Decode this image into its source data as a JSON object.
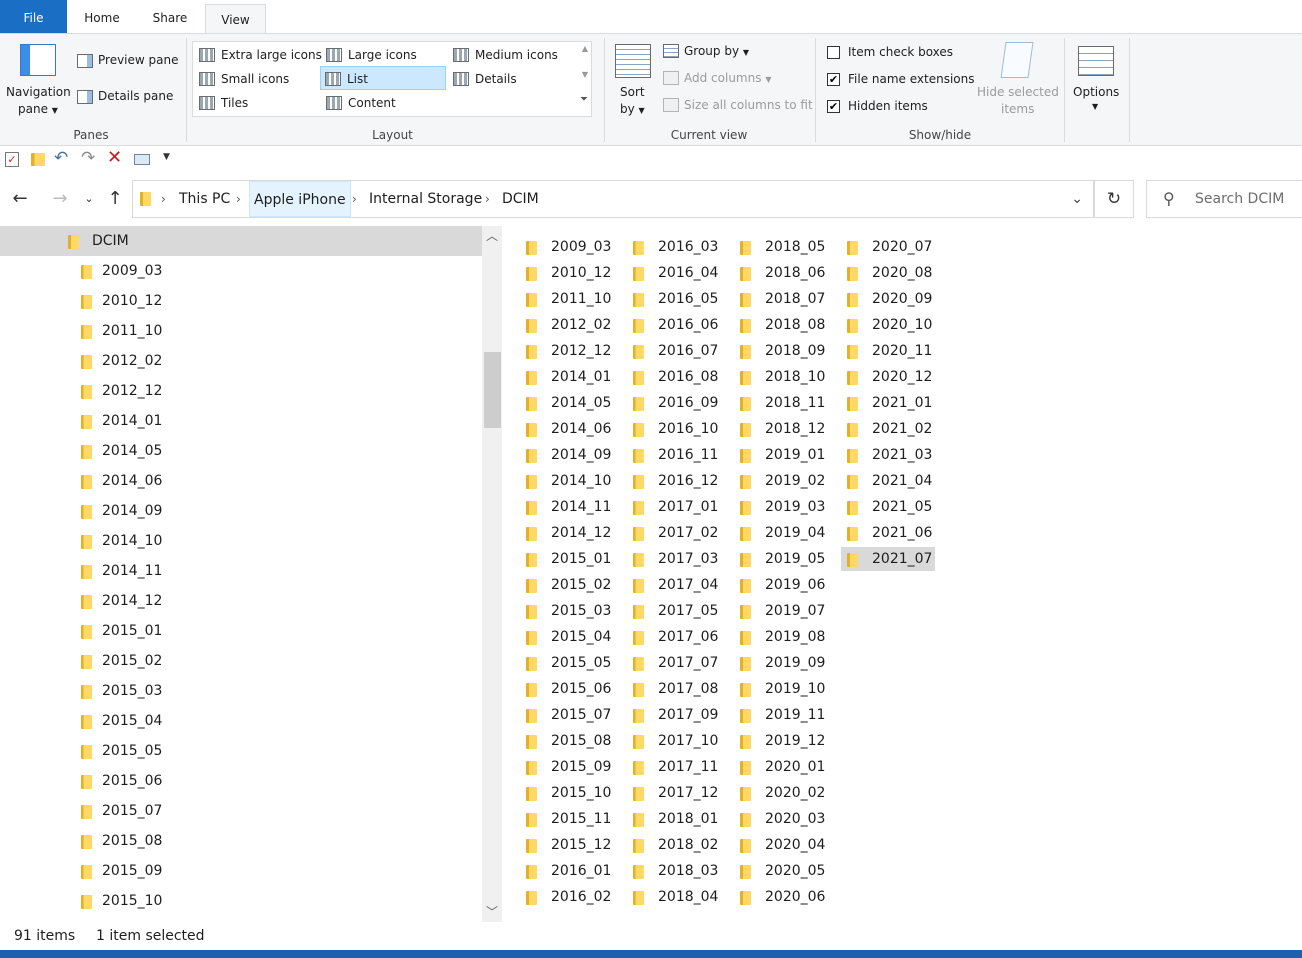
{
  "ribbon": {
    "tabs": {
      "file": "File",
      "home": "Home",
      "share": "Share",
      "view": "View"
    },
    "panes": {
      "navigation_pane_line1": "Navigation",
      "navigation_pane_line2": "pane",
      "preview_pane": "Preview pane",
      "details_pane": "Details pane",
      "group_label": "Panes"
    },
    "layout": {
      "items": [
        "Extra large icons",
        "Large icons",
        "Medium icons",
        "Small icons",
        "List",
        "Details",
        "Tiles",
        "Content"
      ],
      "selected": "List",
      "group_label": "Layout"
    },
    "current_view": {
      "sort_line1": "Sort",
      "sort_line2": "by",
      "group_by": "Group by",
      "add_columns": "Add columns",
      "size_all_columns": "Size all columns to fit",
      "group_label": "Current view"
    },
    "show_hide": {
      "item_check_boxes": "Item check boxes",
      "file_name_extensions": "File name extensions",
      "hidden_items": "Hidden items",
      "hide_selected_line1": "Hide selected",
      "hide_selected_line2": "items",
      "group_label": "Show/hide",
      "checked": {
        "item_check_boxes": false,
        "file_name_extensions": true,
        "hidden_items": true
      }
    },
    "options": "Options"
  },
  "address": {
    "crumbs": [
      "This PC",
      "Apple iPhone",
      "Internal Storage",
      "DCIM"
    ]
  },
  "search": {
    "placeholder": "Search DCIM"
  },
  "nav_pane": {
    "root": "DCIM",
    "items": [
      "2009_03",
      "2010_12",
      "2011_10",
      "2012_02",
      "2012_12",
      "2014_01",
      "2014_05",
      "2014_06",
      "2014_09",
      "2014_10",
      "2014_11",
      "2014_12",
      "2015_01",
      "2015_02",
      "2015_03",
      "2015_04",
      "2015_05",
      "2015_06",
      "2015_07",
      "2015_08",
      "2015_09",
      "2015_10"
    ]
  },
  "files": {
    "columns": [
      [
        "2009_03",
        "2010_12",
        "2011_10",
        "2012_02",
        "2012_12",
        "2014_01",
        "2014_05",
        "2014_06",
        "2014_09",
        "2014_10",
        "2014_11",
        "2014_12",
        "2015_01",
        "2015_02",
        "2015_03",
        "2015_04",
        "2015_05",
        "2015_06",
        "2015_07",
        "2015_08",
        "2015_09",
        "2015_10",
        "2015_11",
        "2015_12",
        "2016_01",
        "2016_02"
      ],
      [
        "2016_03",
        "2016_04",
        "2016_05",
        "2016_06",
        "2016_07",
        "2016_08",
        "2016_09",
        "2016_10",
        "2016_11",
        "2016_12",
        "2017_01",
        "2017_02",
        "2017_03",
        "2017_04",
        "2017_05",
        "2017_06",
        "2017_07",
        "2017_08",
        "2017_09",
        "2017_10",
        "2017_11",
        "2017_12",
        "2018_01",
        "2018_02",
        "2018_03",
        "2018_04"
      ],
      [
        "2018_05",
        "2018_06",
        "2018_07",
        "2018_08",
        "2018_09",
        "2018_10",
        "2018_11",
        "2018_12",
        "2019_01",
        "2019_02",
        "2019_03",
        "2019_04",
        "2019_05",
        "2019_06",
        "2019_07",
        "2019_08",
        "2019_09",
        "2019_10",
        "2019_11",
        "2019_12",
        "2020_01",
        "2020_02",
        "2020_03",
        "2020_04",
        "2020_05",
        "2020_06"
      ],
      [
        "2020_07",
        "2020_08",
        "2020_09",
        "2020_10",
        "2020_11",
        "2020_12",
        "2021_01",
        "2021_02",
        "2021_03",
        "2021_04",
        "2021_05",
        "2021_06",
        "2021_07"
      ]
    ],
    "selected": "2021_07"
  },
  "status": {
    "item_count": "91 items",
    "selection": "1 item selected"
  },
  "colors": {
    "accent": "#1a6fc5",
    "selection": "#cce8ff",
    "selected_row": "#d9d9d9",
    "folder": "#ffd866"
  }
}
